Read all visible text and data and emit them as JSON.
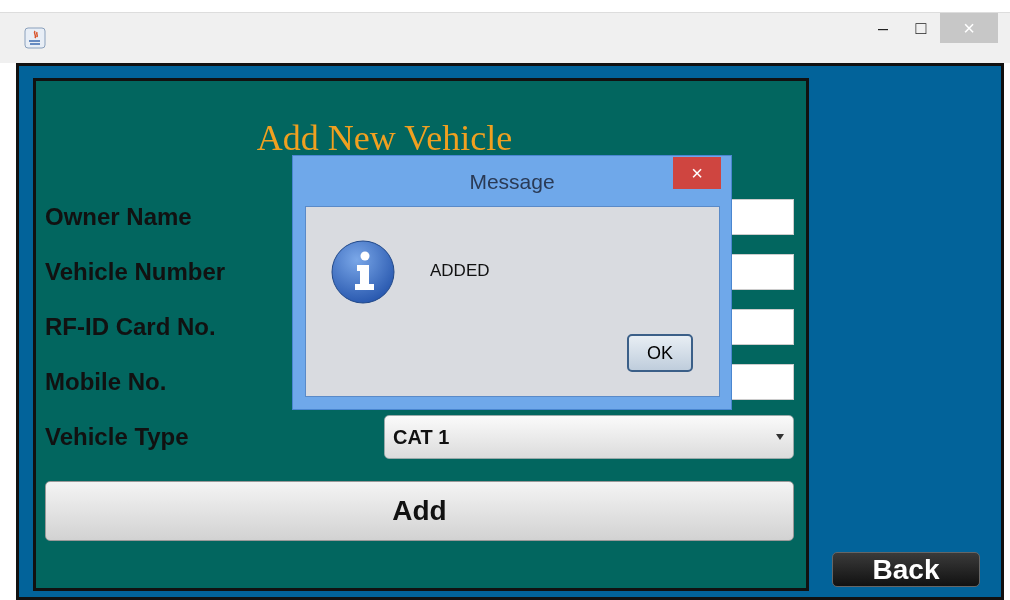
{
  "window": {
    "buttons": [
      "–",
      "□",
      "×"
    ]
  },
  "form": {
    "title": "Add New Vehicle",
    "fields": [
      {
        "label": "Owner Name",
        "kind": "text"
      },
      {
        "label": "Vehicle Number",
        "kind": "text"
      },
      {
        "label": "RF-ID Card No.",
        "kind": "text"
      },
      {
        "label": "Mobile No.",
        "kind": "text"
      },
      {
        "label": "Vehicle Type",
        "kind": "select",
        "value": "CAT 1"
      }
    ],
    "submit": "Add"
  },
  "back": "Back",
  "dialog": {
    "title": "Message",
    "close": "×",
    "message": "ADDED",
    "ok": "OK"
  }
}
